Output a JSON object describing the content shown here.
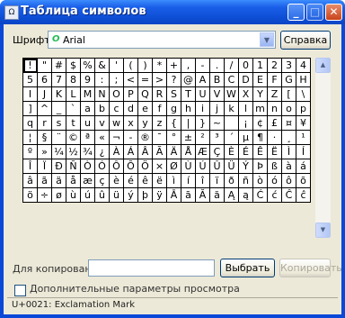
{
  "window": {
    "title": "Таблица символов"
  },
  "font": {
    "label": "Шрифт:",
    "value": "Arial",
    "icon": "opentype-font-icon"
  },
  "buttons": {
    "help": "Справка",
    "select": "Выбрать",
    "copy": "Копировать"
  },
  "chars": [
    "!",
    "\"",
    "#",
    "$",
    "%",
    "&",
    "'",
    "(",
    ")",
    "*",
    "+",
    ",",
    "-",
    ".",
    "/",
    "0",
    "1",
    "2",
    "3",
    "4",
    "5",
    "6",
    "7",
    "8",
    "9",
    ":",
    ";",
    "<",
    "=",
    ">",
    "?",
    "@",
    "A",
    "B",
    "C",
    "D",
    "E",
    "F",
    "G",
    "H",
    "I",
    "J",
    "K",
    "L",
    "M",
    "N",
    "O",
    "P",
    "Q",
    "R",
    "S",
    "T",
    "U",
    "V",
    "W",
    "X",
    "Y",
    "Z",
    "[",
    "\\",
    "]",
    "^",
    "_",
    "`",
    "a",
    "b",
    "c",
    "d",
    "e",
    "f",
    "g",
    "h",
    "i",
    "j",
    "k",
    "l",
    "m",
    "n",
    "o",
    "p",
    "q",
    "r",
    "s",
    "t",
    "u",
    "v",
    "w",
    "x",
    "y",
    "z",
    "{",
    "|",
    "}",
    "~",
    " ",
    "¡",
    "¢",
    "£",
    "¤",
    "¥",
    "¦",
    "§",
    "¨",
    "©",
    "ª",
    "«",
    "¬",
    "-",
    "®",
    "¯",
    "°",
    "±",
    "²",
    "³",
    "´",
    "µ",
    "¶",
    "·",
    "¸",
    "¹",
    "º",
    "»",
    "¼",
    "½",
    "¾",
    "¿",
    "À",
    "Á",
    "Â",
    "Ã",
    "Ä",
    "Å",
    "Æ",
    "Ç",
    "È",
    "É",
    "Ê",
    "Ë",
    "Ì",
    "Í",
    "Î",
    "Ï",
    "Ð",
    "Ñ",
    "Ò",
    "Ó",
    "Ô",
    "Õ",
    "Ö",
    "×",
    "Ø",
    "Ù",
    "Ú",
    "Û",
    "Ü",
    "Ý",
    "Þ",
    "ß",
    "à",
    "á",
    "â",
    "ã",
    "ä",
    "å",
    "æ",
    "ç",
    "è",
    "é",
    "ê",
    "ë",
    "ì",
    "í",
    "î",
    "ï",
    "ð",
    "ñ",
    "ò",
    "ó",
    "ô",
    "õ",
    "ö",
    "÷",
    "ø",
    "ù",
    "ú",
    "û",
    "ü",
    "ý",
    "þ",
    "ÿ",
    "Ā",
    "ā",
    "Ă",
    "ă",
    "Ą",
    "ą",
    "Ć",
    "ć",
    "Ĉ",
    "ĉ"
  ],
  "copy": {
    "label": "Для копирования:",
    "value": ""
  },
  "advanced": {
    "label": "Дополнительные параметры просмотра",
    "checked": false
  },
  "status": "U+0021: Exclamation Mark"
}
